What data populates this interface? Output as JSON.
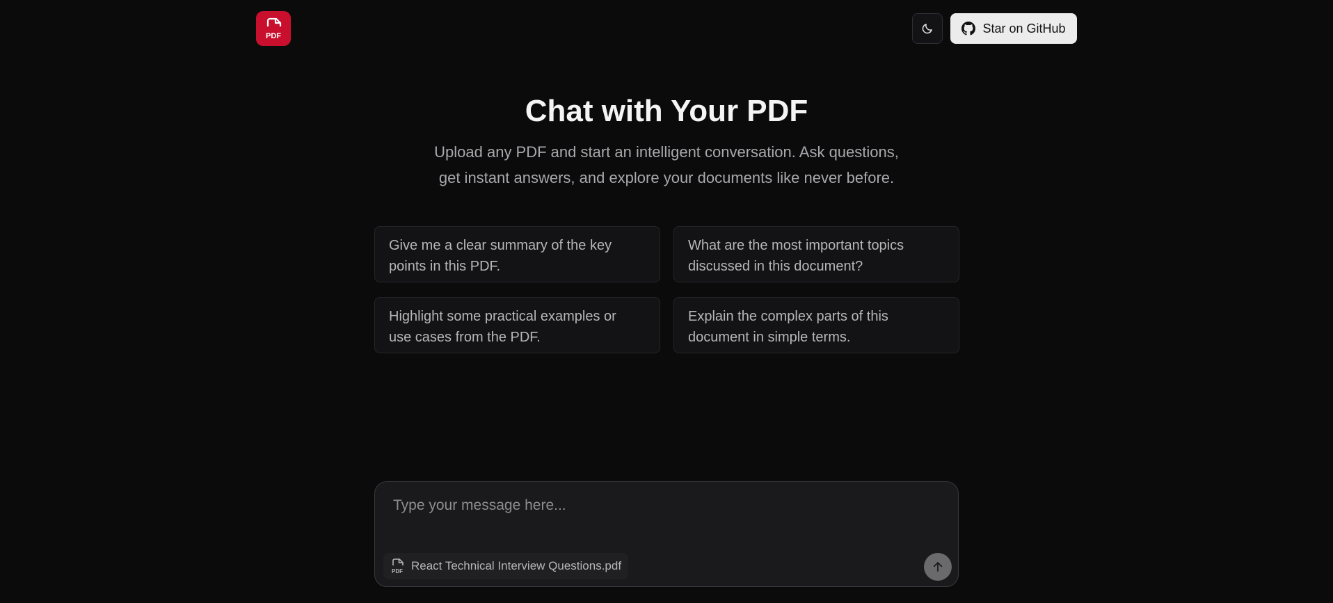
{
  "header": {
    "logo_icon": "pdf-file-icon",
    "logo_text": "PDF",
    "theme_toggle_icon": "moon-icon",
    "github_icon": "github-icon",
    "github_label": "Star on GitHub"
  },
  "hero": {
    "title": "Chat with Your PDF",
    "subtitle_line1": "Upload any PDF and start an intelligent conversation. Ask questions,",
    "subtitle_line2": "get instant answers, and explore your documents like never before."
  },
  "suggestions": [
    {
      "line1": "Give me a clear summary of the key",
      "line2": "points in this PDF."
    },
    {
      "line1": "What are the most important topics",
      "line2": "discussed in this document?"
    },
    {
      "line1": "Highlight some practical examples or",
      "line2": "use cases from the PDF."
    },
    {
      "line1": "Explain the complex parts of this",
      "line2": "document in simple terms."
    }
  ],
  "composer": {
    "placeholder": "Type your message here...",
    "value": "",
    "file_icon": "pdf-file-icon",
    "file_name": "React Technical Interview Questions.pdf",
    "send_icon": "arrow-up-icon"
  },
  "colors": {
    "background": "#0b0b0c",
    "brand": "#c8102e",
    "card": "#131315",
    "composer": "#1a1a1c"
  }
}
